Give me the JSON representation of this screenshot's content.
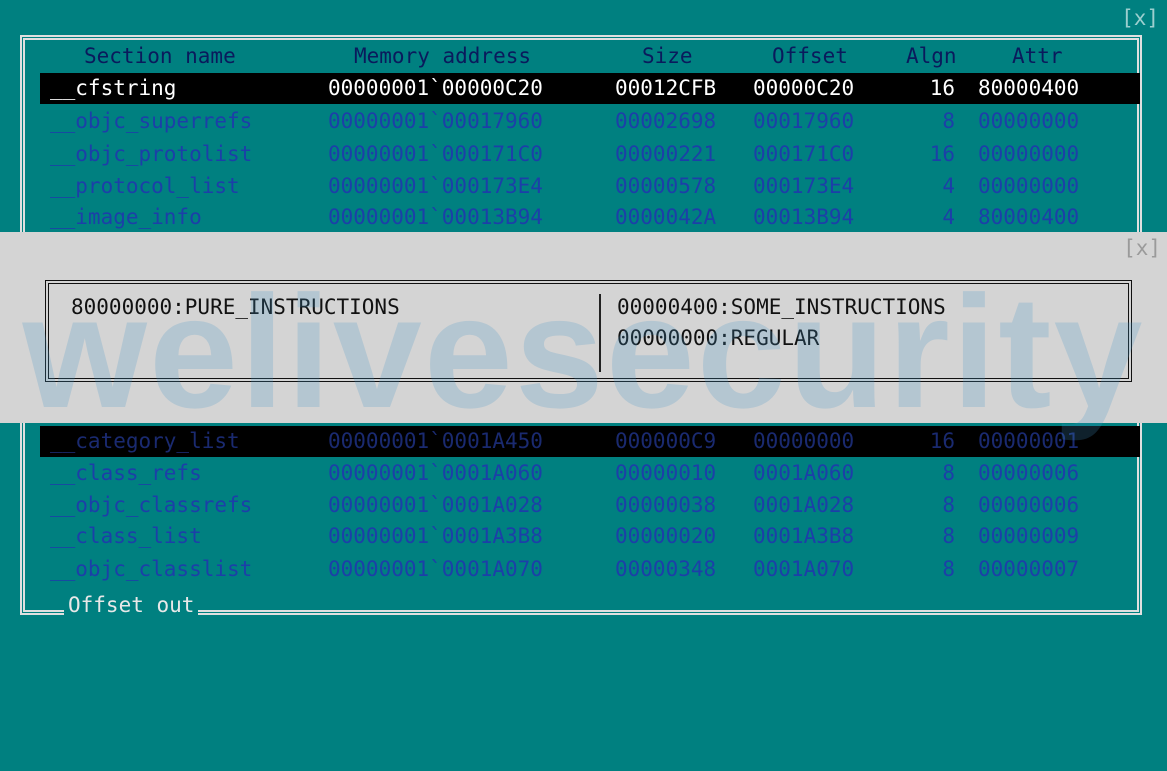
{
  "window": {
    "close_label": "[x]"
  },
  "table": {
    "headers": {
      "name": "Section name",
      "address": "Memory address",
      "size": "Size",
      "offset": "Offset",
      "align": "Algn",
      "attr": "Attr"
    },
    "rows_top": [
      {
        "name": "__cfstring",
        "address": "00000001`00000C20",
        "size": "00012CFB",
        "offset": "00000C20",
        "align": "16",
        "attr": "80000400",
        "selected": true
      },
      {
        "name": "__objc_superrefs",
        "address": "00000001`00017960",
        "size": "00002698",
        "offset": "00017960",
        "align": "8",
        "attr": "00000000"
      },
      {
        "name": "__objc_protolist",
        "address": "00000001`000171C0",
        "size": "00000221",
        "offset": "000171C0",
        "align": "16",
        "attr": "00000000"
      },
      {
        "name": "__protocol_list",
        "address": "00000001`000173E4",
        "size": "00000578",
        "offset": "000173E4",
        "align": "4",
        "attr": "00000000"
      },
      {
        "name": "__image_info",
        "address": "00000001`00013B94",
        "size": "0000042A",
        "offset": "00013B94",
        "align": "4",
        "attr": "80000400"
      }
    ],
    "rows_bottom": [
      {
        "name": "__category_list",
        "address": "00000001`0001A450",
        "size": "000000C9",
        "offset": "00000000",
        "align": "16",
        "attr": "00000001",
        "selected": true
      },
      {
        "name": "__class_refs",
        "address": "00000001`0001A060",
        "size": "00000010",
        "offset": "0001A060",
        "align": "8",
        "attr": "00000006"
      },
      {
        "name": "__objc_classrefs",
        "address": "00000001`0001A028",
        "size": "00000038",
        "offset": "0001A028",
        "align": "8",
        "attr": "00000006"
      },
      {
        "name": "__class_list",
        "address": "00000001`0001A3B8",
        "size": "00000020",
        "offset": "0001A3B8",
        "align": "8",
        "attr": "00000009"
      },
      {
        "name": "__objc_classlist",
        "address": "00000001`0001A070",
        "size": "00000348",
        "offset": "0001A070",
        "align": "8",
        "attr": "00000007"
      }
    ],
    "footer": "Offset out"
  },
  "popup": {
    "close_label": "[x]",
    "left_lines": [
      "80000000:PURE_INSTRUCTIONS"
    ],
    "right_lines": [
      "00000400:SOME_INSTRUCTIONS",
      "00000000:REGULAR"
    ]
  },
  "watermark": "welivesecurity",
  "colors": {
    "background": "#008080",
    "row_text": "#1c3fa8",
    "selected_bg": "#000000",
    "popup_bg": "#d4d4d4"
  }
}
